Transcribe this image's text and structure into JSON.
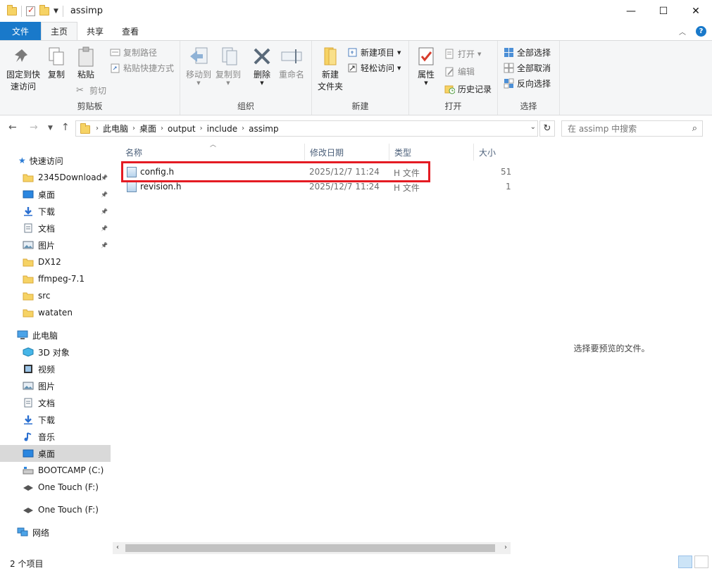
{
  "window": {
    "title": "assimp",
    "controls": [
      "minimize",
      "maximize",
      "close"
    ]
  },
  "ribbon_tabs": [
    {
      "label": "文件"
    },
    {
      "label": "主页"
    },
    {
      "label": "共享"
    },
    {
      "label": "查看"
    }
  ],
  "ribbon": {
    "clipboard": {
      "pin_label_1": "固定到快",
      "pin_label_2": "速访问",
      "copy_label": "复制",
      "paste_label": "粘贴",
      "copy_path_label": "复制路径",
      "paste_shortcut_label": "粘贴快捷方式",
      "cut_label": "剪切",
      "group_label": "剪贴板"
    },
    "organize": {
      "move_to_label": "移动到",
      "copy_to_label": "复制到",
      "delete_label": "删除",
      "rename_label": "重命名",
      "group_label": "组织"
    },
    "new": {
      "new_folder_label_1": "新建",
      "new_folder_label_2": "文件夹",
      "new_item_label": "新建项目",
      "easy_access_label": "轻松访问",
      "group_label": "新建"
    },
    "open": {
      "properties_label": "属性",
      "open_label": "打开",
      "edit_label": "编辑",
      "history_label": "历史记录",
      "group_label": "打开"
    },
    "select": {
      "select_all_label": "全部选择",
      "select_none_label": "全部取消",
      "invert_label": "反向选择",
      "group_label": "选择"
    }
  },
  "address": {
    "crumbs": [
      "此电脑",
      "桌面",
      "output",
      "include",
      "assimp"
    ],
    "search_placeholder": "在 assimp 中搜索"
  },
  "sidebar": {
    "quick_access_label": "快速访问",
    "quick_items": [
      {
        "label": "2345Download",
        "icon": "folder-icon",
        "pinned": true
      },
      {
        "label": "桌面",
        "icon": "desktop-icon",
        "pinned": true
      },
      {
        "label": "下载",
        "icon": "download-icon",
        "pinned": true
      },
      {
        "label": "文档",
        "icon": "document-icon",
        "pinned": true
      },
      {
        "label": "图片",
        "icon": "picture-icon",
        "pinned": true
      },
      {
        "label": "DX12",
        "icon": "folder-icon",
        "pinned": false
      },
      {
        "label": "ffmpeg-7.1",
        "icon": "folder-icon",
        "pinned": false
      },
      {
        "label": "src",
        "icon": "folder-icon",
        "pinned": false
      },
      {
        "label": "wataten",
        "icon": "folder-icon",
        "pinned": false
      }
    ],
    "this_pc_label": "此电脑",
    "pc_items": [
      {
        "label": "3D 对象",
        "icon": "3d-objects-icon"
      },
      {
        "label": "视频",
        "icon": "video-icon"
      },
      {
        "label": "图片",
        "icon": "picture-icon"
      },
      {
        "label": "文档",
        "icon": "document-icon"
      },
      {
        "label": "下载",
        "icon": "download-icon"
      },
      {
        "label": "音乐",
        "icon": "music-icon"
      },
      {
        "label": "桌面",
        "icon": "desktop-icon",
        "selected": true
      },
      {
        "label": "BOOTCAMP (C:)",
        "icon": "drive-icon"
      },
      {
        "label": "One Touch (F:)",
        "icon": "usb-drive-icon"
      }
    ],
    "one_touch_label": "One Touch (F:)",
    "network_label": "网络"
  },
  "file_list": {
    "columns": {
      "name": "名称",
      "date": "修改日期",
      "type": "类型",
      "size": "大小"
    },
    "rows": [
      {
        "name": "config.h",
        "date": "2025/12/7 11:24",
        "type": "H 文件",
        "size": "51",
        "highlighted": true
      },
      {
        "name": "revision.h",
        "date": "2025/12/7 11:24",
        "type": "H 文件",
        "size": "1",
        "highlighted": false
      }
    ]
  },
  "preview": {
    "message": "选择要预览的文件。"
  },
  "status": {
    "item_count": "2 个项目"
  },
  "colors": {
    "accent": "#1979ca",
    "highlight_box": "#e41b23",
    "folder": "#f6d365"
  }
}
